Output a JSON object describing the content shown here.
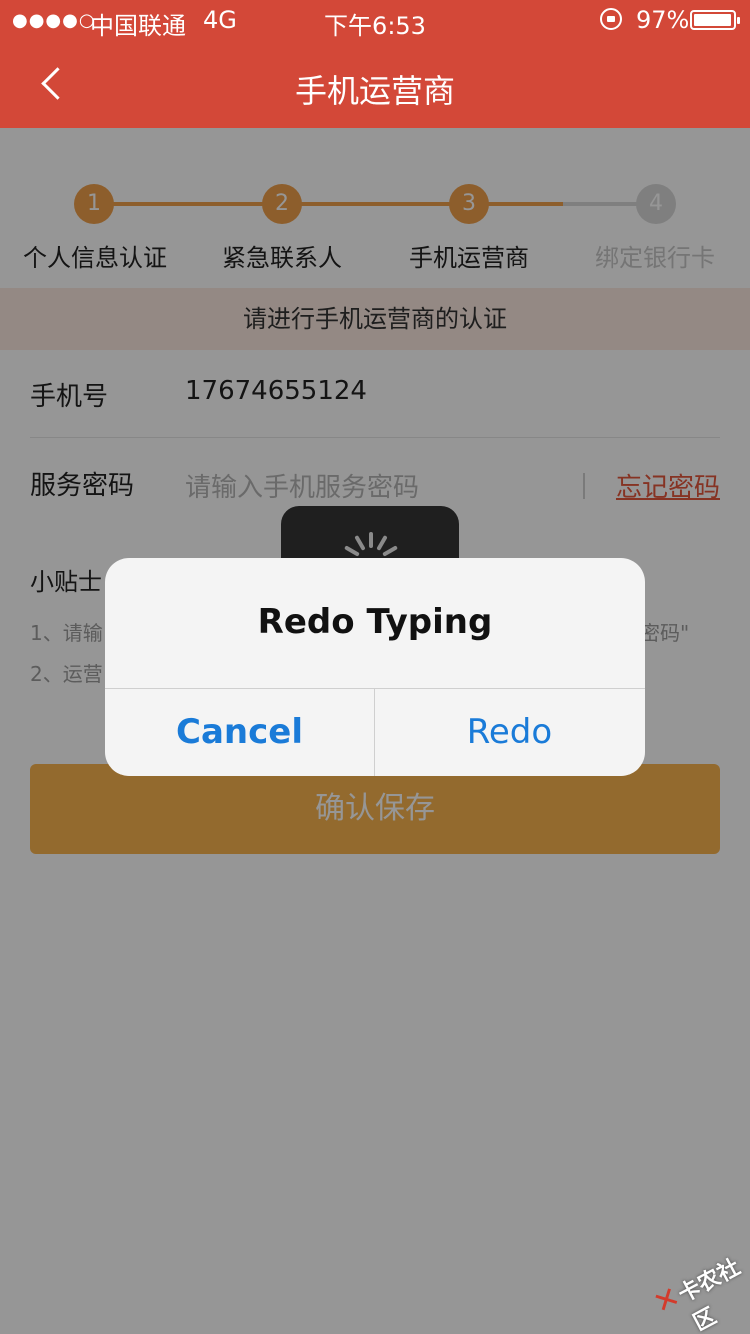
{
  "status_bar": {
    "signal": "●●●●○",
    "carrier": "中国联通",
    "network": "4G",
    "time": "下午6:53",
    "battery": "97%"
  },
  "nav": {
    "title": "手机运营商"
  },
  "steps": [
    {
      "number": "1",
      "label": "个人信息认证",
      "state": "done"
    },
    {
      "number": "2",
      "label": "紧急联系人",
      "state": "done"
    },
    {
      "number": "3",
      "label": "手机运营商",
      "state": "current"
    },
    {
      "number": "4",
      "label": "绑定银行卡",
      "state": "todo"
    }
  ],
  "notice": "请进行手机运营商的认证",
  "form": {
    "phone_label": "手机号",
    "phone_value": "17674655124",
    "password_label": "服务密码",
    "password_placeholder": "请输入手机服务密码",
    "forgot_label": "忘记密码"
  },
  "tips": {
    "title": "小贴士",
    "line1_start": "1、请输",
    "line1_end": "密码\"",
    "line2_start": "2、运营"
  },
  "save_label": "确认保存",
  "alert": {
    "title": "Redo Typing",
    "cancel_label": "Cancel",
    "redo_label": "Redo"
  },
  "watermark": "卡农社区",
  "colors": {
    "brand_red": "#d34838",
    "step_orange": "#f0a04b",
    "link_red": "#e4573d",
    "button_yellow": "#fab44e",
    "alert_blue": "#1a7bd8"
  }
}
